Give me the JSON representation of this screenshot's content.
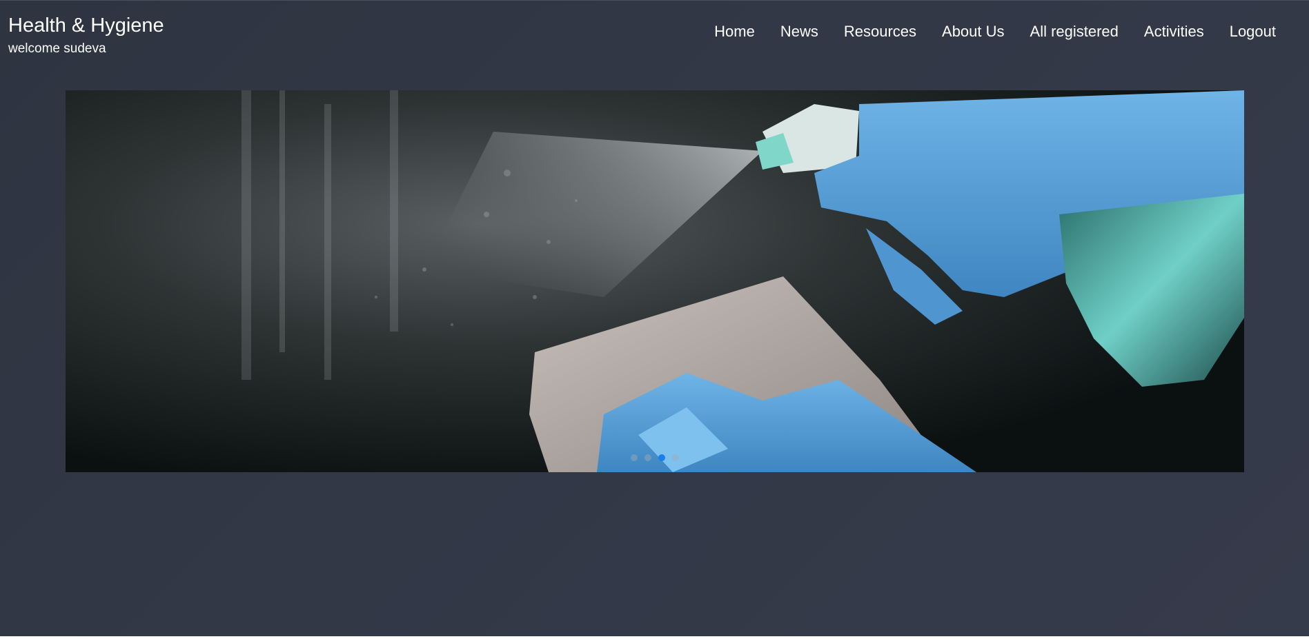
{
  "header": {
    "title": "Health & Hygiene",
    "welcome": "welcome sudeva"
  },
  "nav": {
    "items": [
      {
        "label": "Home"
      },
      {
        "label": "News"
      },
      {
        "label": "Resources"
      },
      {
        "label": "About Us"
      },
      {
        "label": "All registered"
      },
      {
        "label": "Activities"
      },
      {
        "label": "Logout"
      }
    ]
  },
  "carousel": {
    "slide_count": 4,
    "active_index": 2,
    "image_subject": "gloved hands spraying disinfectant and wiping with cloth"
  },
  "colors": {
    "background": "#323846",
    "text": "#ffffff",
    "active_dot": "#1a7fe8"
  }
}
